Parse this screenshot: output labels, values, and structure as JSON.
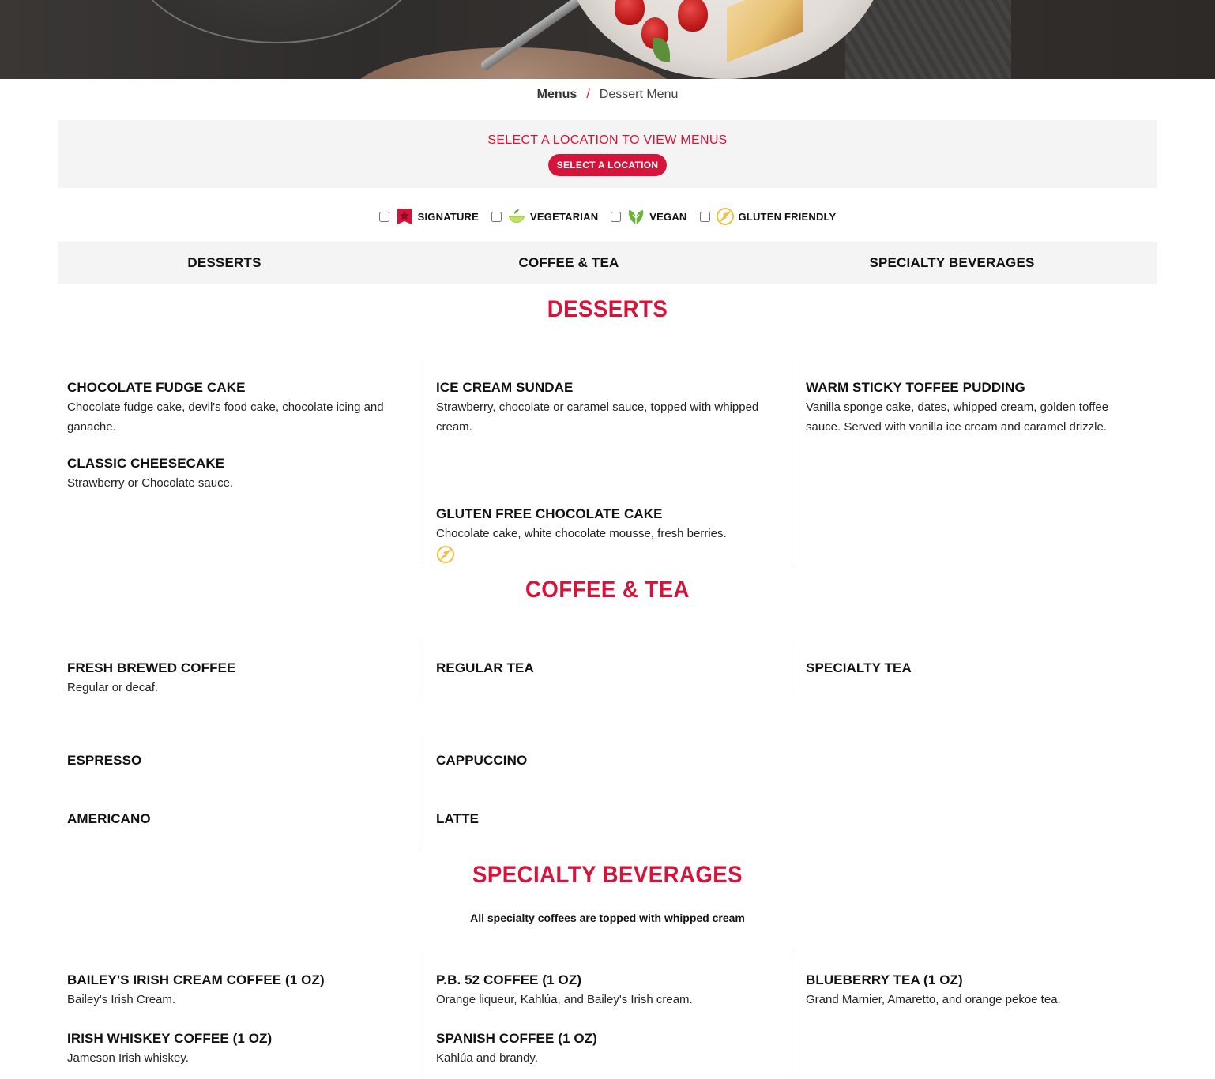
{
  "breadcrumb": {
    "menus": "Menus",
    "separator": "/",
    "current": "Dessert Menu"
  },
  "location": {
    "title": "SELECT A LOCATION TO VIEW MENUS",
    "button": "SELECT A LOCATION"
  },
  "filters": [
    {
      "label": "SIGNATURE",
      "icon": "signature-star-icon",
      "color": "#d6133a"
    },
    {
      "label": "VEGETARIAN",
      "icon": "vegetarian-bowl-icon",
      "color": "#9ccc3c"
    },
    {
      "label": "VEGAN",
      "icon": "vegan-leaf-icon",
      "color": "#6bb33a"
    },
    {
      "label": "GLUTEN FRIENDLY",
      "icon": "gluten-friendly-icon",
      "color": "#f0c040"
    }
  ],
  "tabs": [
    "DESSERTS",
    "COFFEE & TEA",
    "SPECIALTY BEVERAGES"
  ],
  "sections": {
    "desserts": {
      "title": "DESSERTS",
      "items": [
        {
          "name": "CHOCOLATE FUDGE CAKE",
          "desc": "Chocolate fudge cake, devil's food cake, chocolate icing and ganache."
        },
        {
          "name": "ICE CREAM SUNDAE",
          "desc": "Strawberry, chocolate or caramel sauce, topped with whipped cream."
        },
        {
          "name": "WARM STICKY TOFFEE PUDDING",
          "desc": "Vanilla sponge cake, dates, whipped cream, golden toffee sauce. Served with vanilla ice cream and caramel drizzle."
        },
        {
          "name": "CLASSIC CHEESECAKE",
          "desc": "Strawberry or Chocolate sauce."
        },
        {
          "name": "GLUTEN FREE CHOCOLATE CAKE",
          "desc": "Chocolate cake, white chocolate mousse, fresh berries.",
          "icon": "gluten-friendly-icon"
        }
      ]
    },
    "coffee_tea": {
      "title": "COFFEE & TEA",
      "items": [
        {
          "name": "FRESH BREWED COFFEE",
          "desc": "Regular or decaf."
        },
        {
          "name": "REGULAR TEA"
        },
        {
          "name": "SPECIALTY TEA"
        },
        {
          "name": "ESPRESSO"
        },
        {
          "name": "CAPPUCCINO"
        },
        {
          "name": "AMERICANO"
        },
        {
          "name": "LATTE"
        }
      ]
    },
    "specialty": {
      "title": "SPECIALTY BEVERAGES",
      "note": "All specialty coffees are topped with whipped cream",
      "items": [
        {
          "name": "BAILEY'S IRISH CREAM COFFEE (1 OZ)",
          "desc": "Bailey's Irish Cream."
        },
        {
          "name": "P.B. 52 COFFEE (1 OZ)",
          "desc": "Orange liqueur, Kahlúa, and Bailey's Irish cream."
        },
        {
          "name": "BLUEBERRY TEA (1 OZ)",
          "desc": "Grand Marnier, Amaretto, and orange pekoe tea."
        },
        {
          "name": "IRISH WHISKEY COFFEE (1 OZ)",
          "desc": "Jameson Irish whiskey."
        },
        {
          "name": "SPANISH COFFEE (1 OZ)",
          "desc": "Kahlúa and brandy."
        }
      ]
    }
  }
}
